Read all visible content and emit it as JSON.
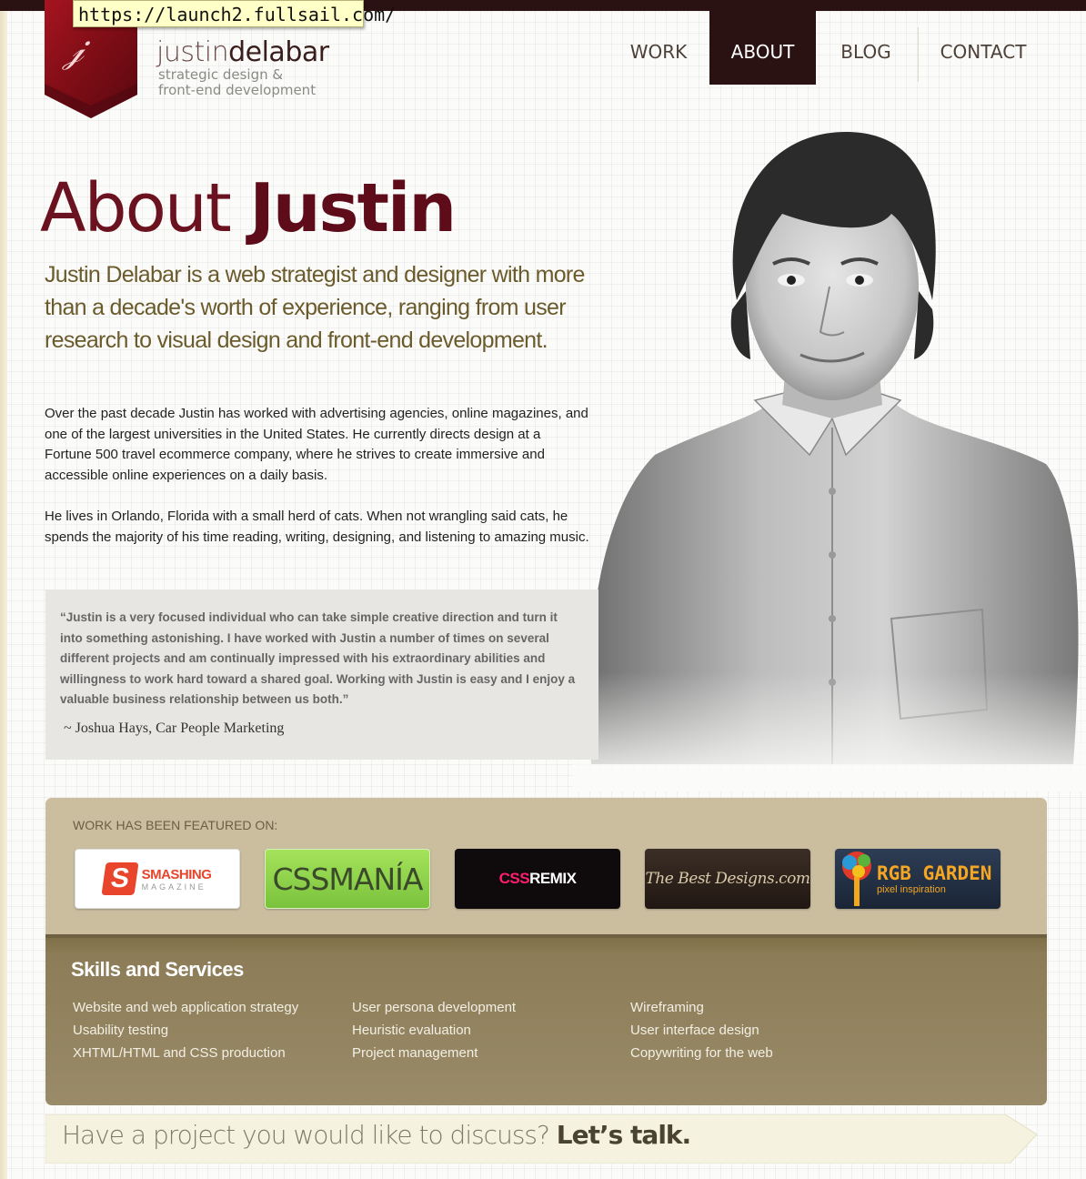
{
  "browser": {
    "url": "https://launch2.fullsail.com/"
  },
  "brand": {
    "name_light": "justin",
    "name_bold": "delabar",
    "tagline_1": "strategic design &",
    "tagline_2": "front-end development",
    "logo_letter": "jd"
  },
  "nav": {
    "items": [
      {
        "label": "WORK"
      },
      {
        "label": "ABOUT"
      },
      {
        "label": "BLOG"
      },
      {
        "label": "CONTACT"
      }
    ],
    "active": "ABOUT"
  },
  "page": {
    "title_light": "About",
    "title_bold": "Justin",
    "lead": "Justin Delabar is a web strategist and designer with more than a decade's worth of experience, ranging from user research to visual design and front-end development.",
    "paragraphs": [
      "Over the past decade Justin has worked with advertising agencies, online magazines, and one of the largest universities in the United States. He currently directs design at a Fortune 500 travel ecommerce company, where he strives to create immersive and accessible online experiences on a daily basis.",
      "He lives in Orlando, Florida with a small herd of cats. When not wrangling said cats, he spends the majority of his time reading, writing, designing, and listening to amazing music."
    ],
    "quote": "“Justin is a very focused individual who can take simple creative direction and turn it into something astonishing. I have worked with Justin a number of times on several different projects and am continually impressed with his extraordinary abilities and willingness to work hard toward a shared goal. Working with Justin is easy and I enjoy a valuable business relationship between us both.”",
    "quote_cite": "~ Joshua Hays, Car People Marketing"
  },
  "featured": {
    "title": "WORK HAS BEEN FEATURED ON:",
    "badges": [
      {
        "name": "smashing",
        "line1": "SMASHING",
        "line2": "MAGAZINE"
      },
      {
        "name": "cssmania",
        "text": "CSSMANÍA"
      },
      {
        "name": "cssremix",
        "text_a": "CSS",
        "text_b": "REMIX"
      },
      {
        "name": "thebestdesigns",
        "text": "The Best Designs.com"
      },
      {
        "name": "rgbgarden",
        "line1": "RGB GARDEN",
        "line2": "pixel inspiration"
      }
    ]
  },
  "skills": {
    "title": "Skills and Services",
    "columns": [
      [
        "Website and web application strategy",
        "Usability testing",
        "XHTML/HTML and CSS production"
      ],
      [
        "User persona development",
        "Heuristic evaluation",
        "Project management"
      ],
      [
        "Wireframing",
        "User interface design",
        "Copywriting for the web"
      ]
    ]
  },
  "cta": {
    "text": "Have a project you would like to discuss?",
    "bold": "Let’s talk."
  },
  "colors": {
    "dark_maroon": "#2a1112",
    "title_maroon": "#6b1220",
    "lead_olive": "#6b5b2c",
    "featured_tan": "#cbbe9f",
    "skills_brown": "#8c7c57"
  }
}
